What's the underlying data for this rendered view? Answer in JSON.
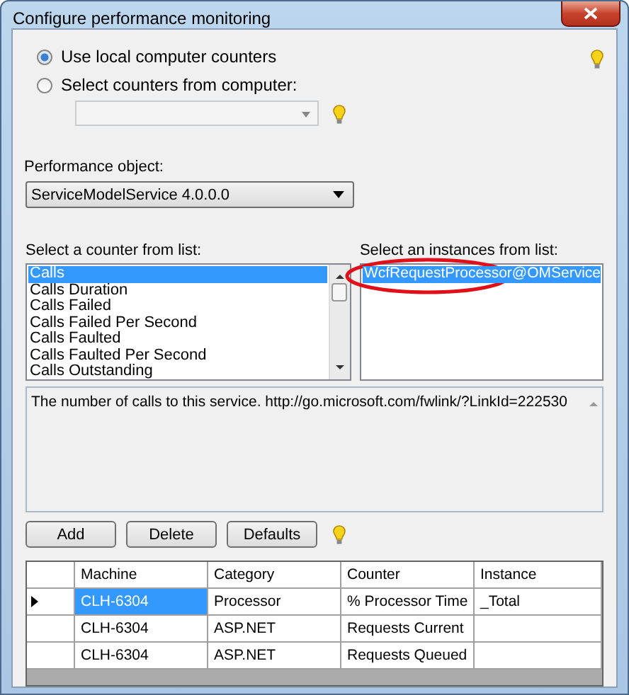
{
  "window": {
    "title": "Configure performance monitoring"
  },
  "source": [
    {
      "label": "Use local computer counters",
      "selected": true
    },
    {
      "label": "Select counters from computer:",
      "selected": false
    }
  ],
  "computer_combo": {
    "disabled": true
  },
  "performance_object": {
    "label": "Performance object:",
    "value": "ServiceModelService 4.0.0.0"
  },
  "counters": {
    "label": "Select a counter from list:",
    "items": [
      {
        "text": "Calls",
        "selected": true
      },
      {
        "text": "Calls Duration",
        "selected": false
      },
      {
        "text": "Calls Failed",
        "selected": false
      },
      {
        "text": "Calls Failed Per Second",
        "selected": false
      },
      {
        "text": "Calls Faulted",
        "selected": false
      },
      {
        "text": "Calls Faulted Per Second",
        "selected": false
      },
      {
        "text": "Calls Outstanding",
        "selected": false
      }
    ]
  },
  "instances": {
    "label": "Select an instances from list:",
    "items": [
      {
        "text": "WcfRequestProcessor@OMService",
        "selected": true
      }
    ]
  },
  "description": "The number of calls to this service. http://go.microsoft.com/fwlink/?LinkId=222530",
  "buttons": [
    "Add",
    "Delete",
    "Defaults"
  ],
  "grid": {
    "columns": [
      "Machine",
      "Category",
      "Counter",
      "Instance"
    ],
    "rows": [
      {
        "cells": [
          "CLH-6304",
          "Processor",
          "% Processor Time",
          "_Total"
        ],
        "selected": true
      },
      {
        "cells": [
          "CLH-6304",
          "ASP.NET",
          "Requests Current",
          ""
        ],
        "selected": false
      },
      {
        "cells": [
          "CLH-6304",
          "ASP.NET",
          "Requests Queued",
          ""
        ],
        "selected": false
      }
    ]
  }
}
